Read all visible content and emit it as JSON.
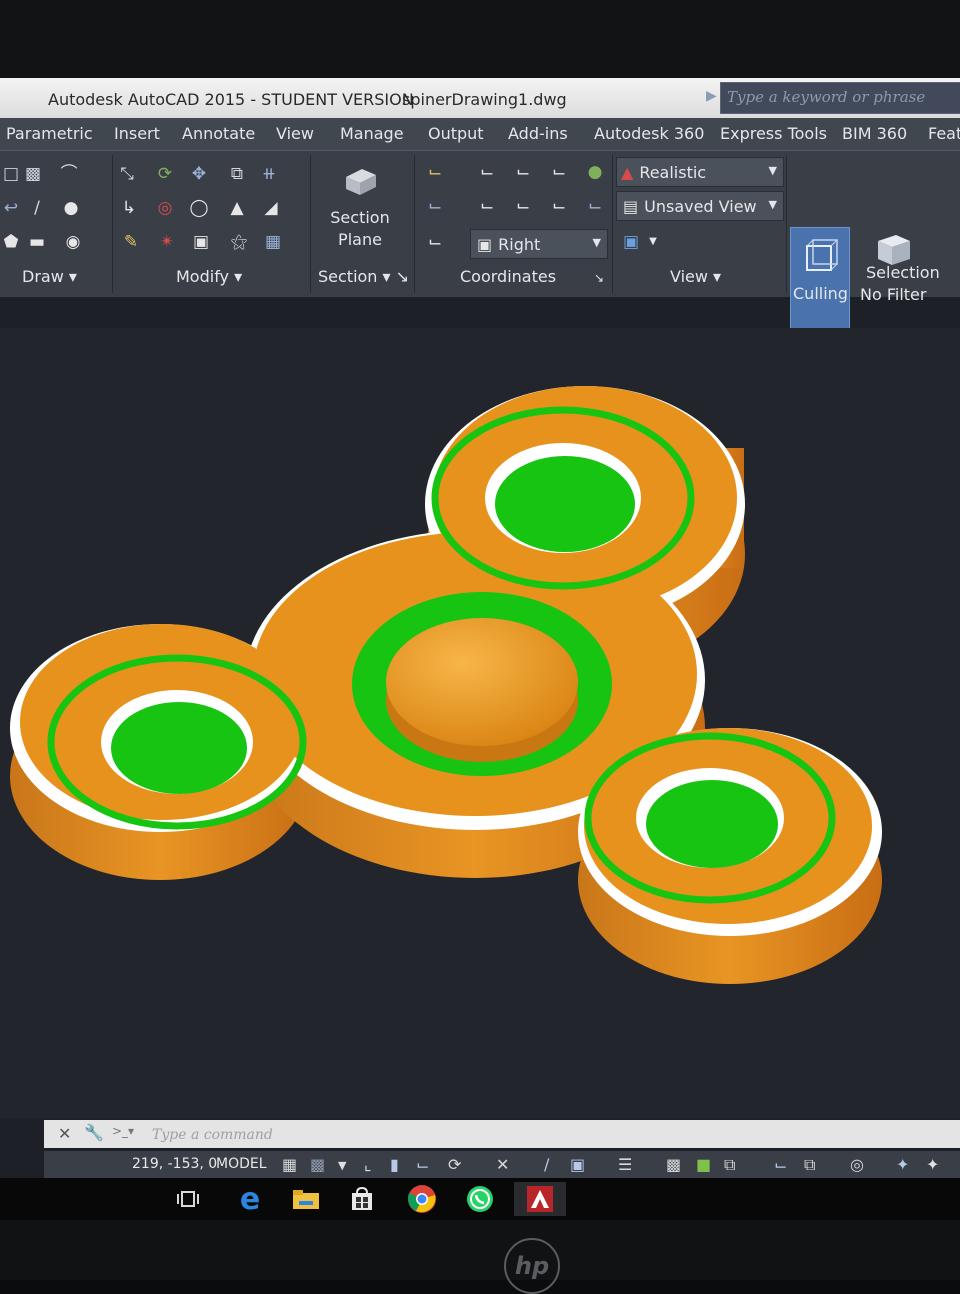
{
  "window": {
    "app_title": "Autodesk AutoCAD 2015 - STUDENT VERSION",
    "file_name": "spinerDrawing1.dwg",
    "search_placeholder": "Type a keyword or phrase"
  },
  "menu_tabs": [
    "Parametric",
    "Insert",
    "Annotate",
    "View",
    "Manage",
    "Output",
    "Add-ins",
    "Autodesk 360",
    "Express Tools",
    "BIM 360",
    "Featu"
  ],
  "ribbon": {
    "panels": {
      "draw": "Draw",
      "modify": "Modify",
      "section": "Section",
      "coordinates": "Coordinates",
      "view": "View",
      "selection": "Selection"
    },
    "section_plane_line1": "Section",
    "section_plane_line2": "Plane",
    "visual_style": "Realistic",
    "named_view": "Unsaved View",
    "view_direction": "Right",
    "culling_label": "Culling",
    "filter_label": "No Filter"
  },
  "command_line": {
    "placeholder": "Type a command"
  },
  "status_bar": {
    "coordinates": "219, -153, 0",
    "mode": "MODEL"
  },
  "colors": {
    "spinner_orange": "#e7921c",
    "bearing_green": "#17c412",
    "edge_white": "#ffffff",
    "viewport_bg": "#22252c"
  },
  "taskbar_icons": [
    "task-view-icon",
    "edge-browser-icon",
    "file-explorer-icon",
    "store-icon",
    "chrome-icon",
    "whatsapp-icon",
    "autocad-icon"
  ],
  "brand": "hp"
}
